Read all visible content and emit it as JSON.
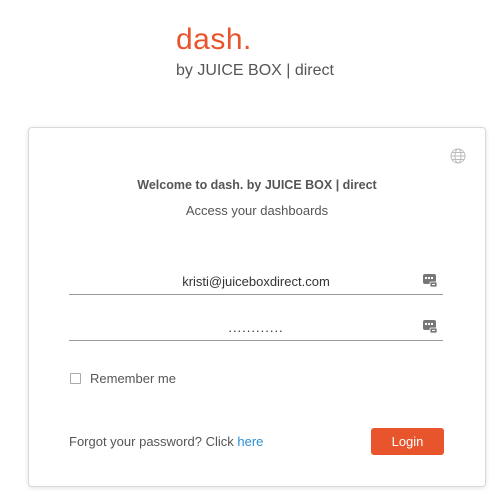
{
  "brand": {
    "name": "dash.",
    "tagline": "by JUICE BOX | direct"
  },
  "login_card": {
    "welcome": "Welcome to dash. by JUICE BOX | direct",
    "subtitle": "Access your dashboards",
    "email_value": "kristi@juiceboxdirect.com",
    "password_value": "............",
    "remember_label": "Remember me",
    "remember_checked": false,
    "forgot_text": "Forgot your password? Click",
    "forgot_link": "here",
    "login_label": "Login",
    "icons": {
      "language": "globe-icon",
      "email_keyboard": "keyboard-icon",
      "password_keyboard": "keyboard-icon"
    }
  },
  "colors": {
    "accent": "#e8552d",
    "link": "#2b8fd6"
  }
}
